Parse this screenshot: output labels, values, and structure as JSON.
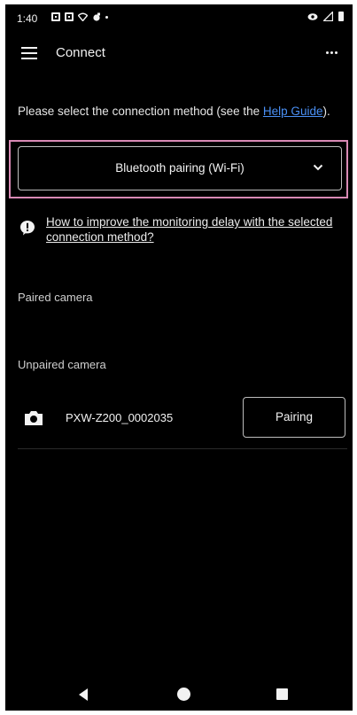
{
  "status_bar": {
    "time": "1:40"
  },
  "app_bar": {
    "title": "Connect"
  },
  "instruction": {
    "text": "Please select the connection method (see the ",
    "link": "Help Guide",
    "suffix": ")."
  },
  "connection_method": {
    "selected": "Bluetooth pairing (Wi-Fi)"
  },
  "help_link": {
    "text": "How to improve the monitoring delay with the selected connection method?"
  },
  "sections": {
    "paired_label": "Paired camera",
    "unpaired_label": "Unpaired camera"
  },
  "unpaired_cameras": [
    {
      "name": "PXW-Z200_0002035",
      "action_label": "Pairing"
    }
  ],
  "icons": {
    "menu": "hamburger-menu-icon",
    "overflow": "more-options-icon",
    "dropdown": "chevron-down-icon",
    "info": "info-icon",
    "camera": "camera-icon",
    "nav_back": "back-triangle-icon",
    "nav_home": "home-circle-icon",
    "nav_recents": "recents-square-icon"
  },
  "colors": {
    "background": "#000000",
    "text": "#f2f2f2",
    "link": "#4a90f5",
    "highlight_border": "#d98ab5"
  }
}
